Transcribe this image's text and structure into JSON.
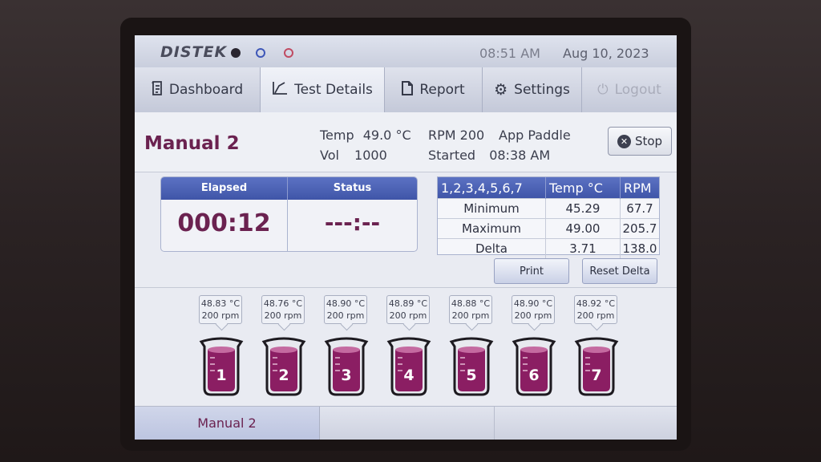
{
  "app": {
    "brand": "DISTEK",
    "time": "08:51 AM",
    "date": "Aug 10, 2023",
    "status_dots": [
      {
        "color": "#2a2630"
      },
      {
        "color": "#3e57b8"
      },
      {
        "color": "#c04b62"
      }
    ]
  },
  "nav": {
    "tabs": [
      {
        "label": "Dashboard",
        "icon": "dashboard-icon"
      },
      {
        "label": "Test Details",
        "icon": "chart-line-icon",
        "active": true
      },
      {
        "label": "Report",
        "icon": "document-icon"
      },
      {
        "label": "Settings",
        "icon": "gear-icon"
      },
      {
        "label": "Logout",
        "icon": "power-icon",
        "disabled": true
      }
    ]
  },
  "test": {
    "name": "Manual 2",
    "temp_label": "Temp",
    "temp_value": "49.0 °C",
    "rpm_label": "RPM",
    "rpm_value": "200",
    "app_label": "App",
    "app_value": "Paddle",
    "vol_label": "Vol",
    "vol_value": "1000",
    "started_label": "Started",
    "started_value": "08:38 AM",
    "stop_label": "Stop"
  },
  "timer": {
    "elapsed_label": "Elapsed",
    "elapsed_value": "000:12",
    "status_label": "Status",
    "status_value": "---:--"
  },
  "stats": {
    "headers": [
      "1,2,3,4,5,6,7",
      "Temp °C",
      "RPM"
    ],
    "rows": [
      {
        "label": "Minimum",
        "temp": "45.29",
        "rpm": "67.7"
      },
      {
        "label": "Maximum",
        "temp": "49.00",
        "rpm": "205.7"
      },
      {
        "label": "Delta",
        "temp": "3.71",
        "rpm": "138.0"
      }
    ]
  },
  "actions": {
    "print_label": "Print",
    "reset_label": "Reset Delta"
  },
  "vessels": [
    {
      "num": "1",
      "temp": "48.83 °C",
      "rpm": "200 rpm"
    },
    {
      "num": "2",
      "temp": "48.76 °C",
      "rpm": "200 rpm"
    },
    {
      "num": "3",
      "temp": "48.90 °C",
      "rpm": "200 rpm"
    },
    {
      "num": "4",
      "temp": "48.89 °C",
      "rpm": "200 rpm"
    },
    {
      "num": "5",
      "temp": "48.88 °C",
      "rpm": "200 rpm"
    },
    {
      "num": "6",
      "temp": "48.90 °C",
      "rpm": "200 rpm"
    },
    {
      "num": "7",
      "temp": "48.92 °C",
      "rpm": "200 rpm"
    }
  ],
  "colors": {
    "accent": "#6b2250",
    "vessel_fill": "#8b1e63",
    "header_blue": "#4a5fb3"
  },
  "footer": {
    "active_tab": "Manual 2"
  }
}
